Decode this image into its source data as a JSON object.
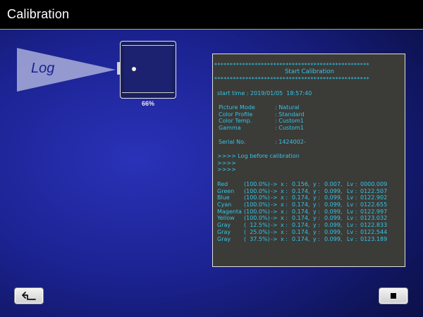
{
  "header": {
    "title": "Calibration"
  },
  "visual": {
    "log_label": "Log",
    "progress_label": "66%",
    "progress": 0.66
  },
  "log": {
    "stars": "**************************************************",
    "header_title": "Start Calibration",
    "start_time": "start time : 2019/01/05  18:57:40",
    "settings": [
      {
        "label": "Picture Mode",
        "value": ": Natural"
      },
      {
        "label": "Color Profile",
        "value": ": Standard"
      },
      {
        "label": "Color Temp.",
        "value": ": Custom1"
      },
      {
        "label": "Gamma",
        "value": ": Custom1"
      }
    ],
    "serial": {
      "label": "Serial No.",
      "value": ": 1424002-"
    },
    "prompt_lines": [
      ">>>> Log before calibration",
      ">>>>",
      ">>>>"
    ],
    "rows": [
      {
        "name": "Red",
        "pct": "(100.0%)",
        "x": "0.156,",
        "y": "0.007,",
        "lv": "0000.009"
      },
      {
        "name": "Green",
        "pct": "(100.0%)",
        "x": "0.174,",
        "y": "0.099,",
        "lv": "0122.507"
      },
      {
        "name": "Blue",
        "pct": "(100.0%)",
        "x": "0.174,",
        "y": "0.099,",
        "lv": "0122.902"
      },
      {
        "name": "Cyan",
        "pct": "(100.0%)",
        "x": "0.174,",
        "y": "0.099,",
        "lv": "0122.655"
      },
      {
        "name": "Magenta",
        "pct": "(100.0%)",
        "x": "0.174,",
        "y": "0.099,",
        "lv": "0122.997"
      },
      {
        "name": "Yellow",
        "pct": "(100.0%)",
        "x": "0.174,",
        "y": "0.099,",
        "lv": "0123.032"
      },
      {
        "name": "Gray",
        "pct": "(  12.5%)",
        "x": "0.174,",
        "y": "0.099,",
        "lv": "0122.833"
      },
      {
        "name": "Gray",
        "pct": "(  25.0%)",
        "x": "0.174,",
        "y": "0.099,",
        "lv": "0122.544"
      },
      {
        "name": "Gray",
        "pct": "(  37.5%)",
        "x": "0.174,",
        "y": "0.099,",
        "lv": "0123.189"
      }
    ],
    "labels": {
      "arrow": "->",
      "x": "x :",
      "y": "y :",
      "lv": "Lv :"
    }
  },
  "buttons": {
    "back_icon": "return-arrow-icon",
    "stop_icon": "stop-square-icon"
  }
}
